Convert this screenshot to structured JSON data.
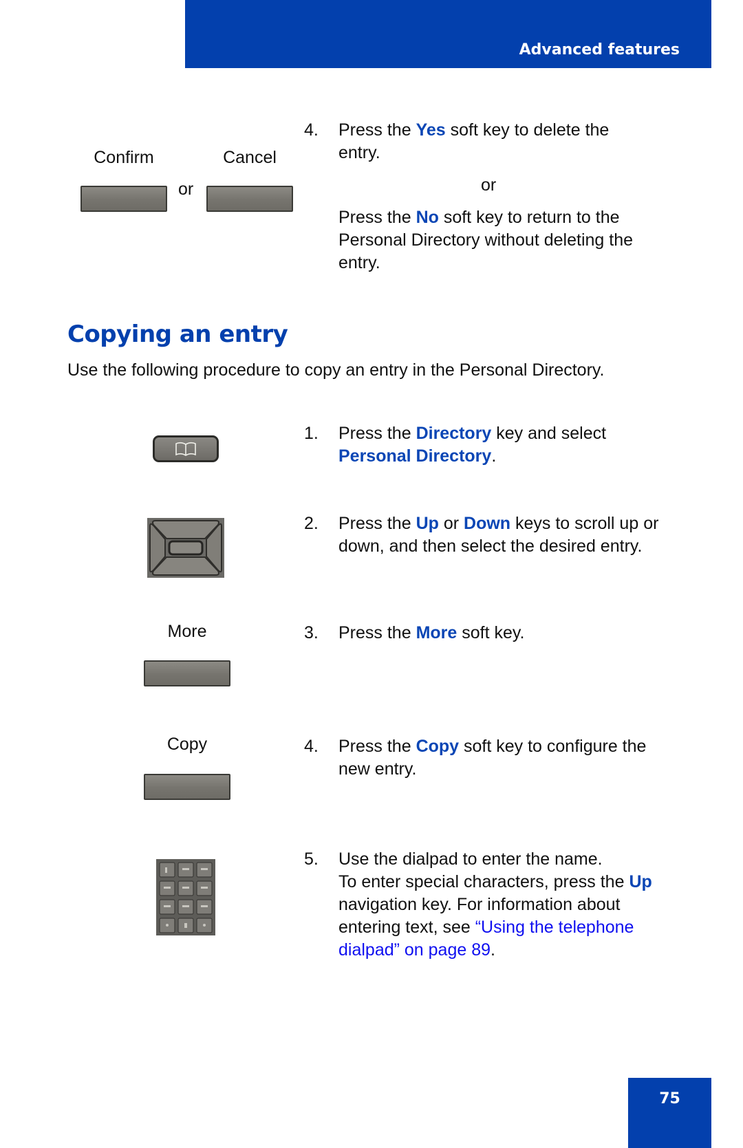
{
  "header": {
    "section_title": "Advanced features",
    "color": "#0340ad"
  },
  "top_block": {
    "keys": [
      {
        "label": "Confirm"
      },
      {
        "label": "Cancel"
      }
    ],
    "or_between_keys": "or",
    "step": {
      "number": "4.",
      "part1_pre": "Press the ",
      "part1_key": "Yes",
      "part1_post": " soft key to delete the entry.",
      "or": "or",
      "part2_pre": "Press the ",
      "part2_key": "No",
      "part2_post": " soft key to return to the Personal Directory without deleting the entry."
    }
  },
  "section": {
    "title": "Copying an entry",
    "intro": "Use the following procedure to copy an entry in the Personal Directory.",
    "steps": [
      {
        "number": "1.",
        "pre": "Press the ",
        "key": "Directory",
        "mid": " key and select ",
        "key2": "Personal Directory",
        "post": ".",
        "icon": "directory-key-icon"
      },
      {
        "number": "2.",
        "pre": "Press the ",
        "key": "Up",
        "mid": " or ",
        "key2": "Down",
        "post": " keys to scroll up or down, and then select the desired entry.",
        "icon": "navigation-cluster-icon"
      },
      {
        "number": "3.",
        "pre": "Press the ",
        "key": "More",
        "post": " soft key.",
        "softkey_label": "More"
      },
      {
        "number": "4.",
        "pre": "Press the ",
        "key": "Copy",
        "post": " soft key to configure the new entry.",
        "softkey_label": "Copy"
      },
      {
        "number": "5.",
        "line1": "Use the dialpad to enter the name.",
        "pre": "To enter special characters, press the ",
        "key": "Up",
        "mid": " navigation key. For information about entering text, see ",
        "link": "“Using the telephone dialpad” on page 89",
        "post": ".",
        "icon": "dialpad-icon"
      }
    ]
  },
  "footer": {
    "page_number": "75"
  }
}
